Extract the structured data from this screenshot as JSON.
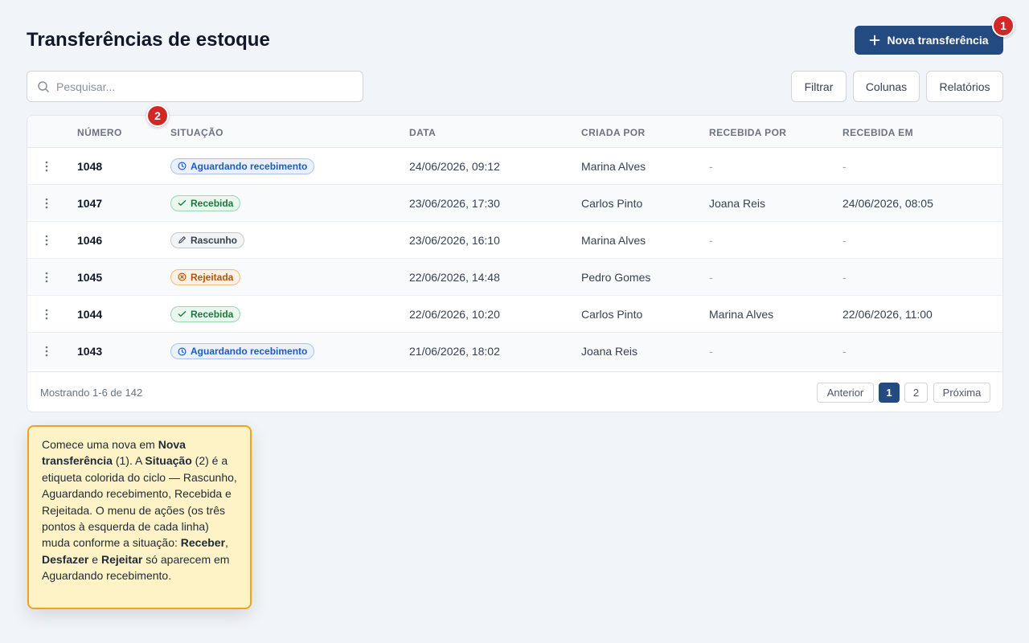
{
  "header": {
    "title": "Transferências de estoque",
    "new_button": "Nova transferência",
    "badge1": "1",
    "badge2": "2"
  },
  "search": {
    "placeholder": "Pesquisar...",
    "value": ""
  },
  "toolbar": {
    "filter": "Filtrar",
    "columns": "Colunas",
    "reports": "Relatórios"
  },
  "table": {
    "columns": [
      "NÚMERO",
      "SITUAÇÃO",
      "DATA",
      "CRIADA POR",
      "RECEBIDA POR",
      "RECEBIDA EM"
    ],
    "rows": [
      {
        "number": "1048",
        "status": "Aguardando recebimento",
        "status_kind": "waiting",
        "date": "24/06/2026, 09:12",
        "created_by": "Marina Alves",
        "received_by": "-",
        "received_at": "-"
      },
      {
        "number": "1047",
        "status": "Recebida",
        "status_kind": "received",
        "date": "23/06/2026, 17:30",
        "created_by": "Carlos Pinto",
        "received_by": "Joana Reis",
        "received_at": "24/06/2026, 08:05"
      },
      {
        "number": "1046",
        "status": "Rascunho",
        "status_kind": "draft",
        "date": "23/06/2026, 16:10",
        "created_by": "Marina Alves",
        "received_by": "-",
        "received_at": "-"
      },
      {
        "number": "1045",
        "status": "Rejeitada",
        "status_kind": "rejected",
        "date": "22/06/2026, 14:48",
        "created_by": "Pedro Gomes",
        "received_by": "-",
        "received_at": "-"
      },
      {
        "number": "1044",
        "status": "Recebida",
        "status_kind": "received",
        "date": "22/06/2026, 10:20",
        "created_by": "Carlos Pinto",
        "received_by": "Marina Alves",
        "received_at": "22/06/2026, 11:00"
      },
      {
        "number": "1043",
        "status": "Aguardando recebimento",
        "status_kind": "waiting",
        "date": "21/06/2026, 18:02",
        "created_by": "Joana Reis",
        "received_by": "-",
        "received_at": "-"
      }
    ]
  },
  "footer": {
    "showing": "Mostrando 1-6 de 142",
    "prev": "Anterior",
    "pages": [
      "1",
      "2"
    ],
    "current_page": "1",
    "next": "Próxima"
  },
  "colors": {
    "primary": "#244a82",
    "badge": "#d22727",
    "callout_bg": "#fef3c7",
    "callout_border": "#f0a21f"
  },
  "callout": {
    "t1": "Comece uma nova em ",
    "b1": "Nova transferência",
    "t2": " (1). A ",
    "b2": "Situação",
    "t3": " (2) é a etiqueta colorida do ciclo — Rascunho, Aguardando recebimento, Recebida e Rejeitada. O menu de ações (os três pontos à esquerda de cada linha) muda conforme a situação: ",
    "b3": "Receber",
    "t4": ", ",
    "b4": "Desfazer",
    "t5": " e ",
    "b5": "Rejeitar",
    "t6": " só aparecem em Aguardando recebimento."
  }
}
